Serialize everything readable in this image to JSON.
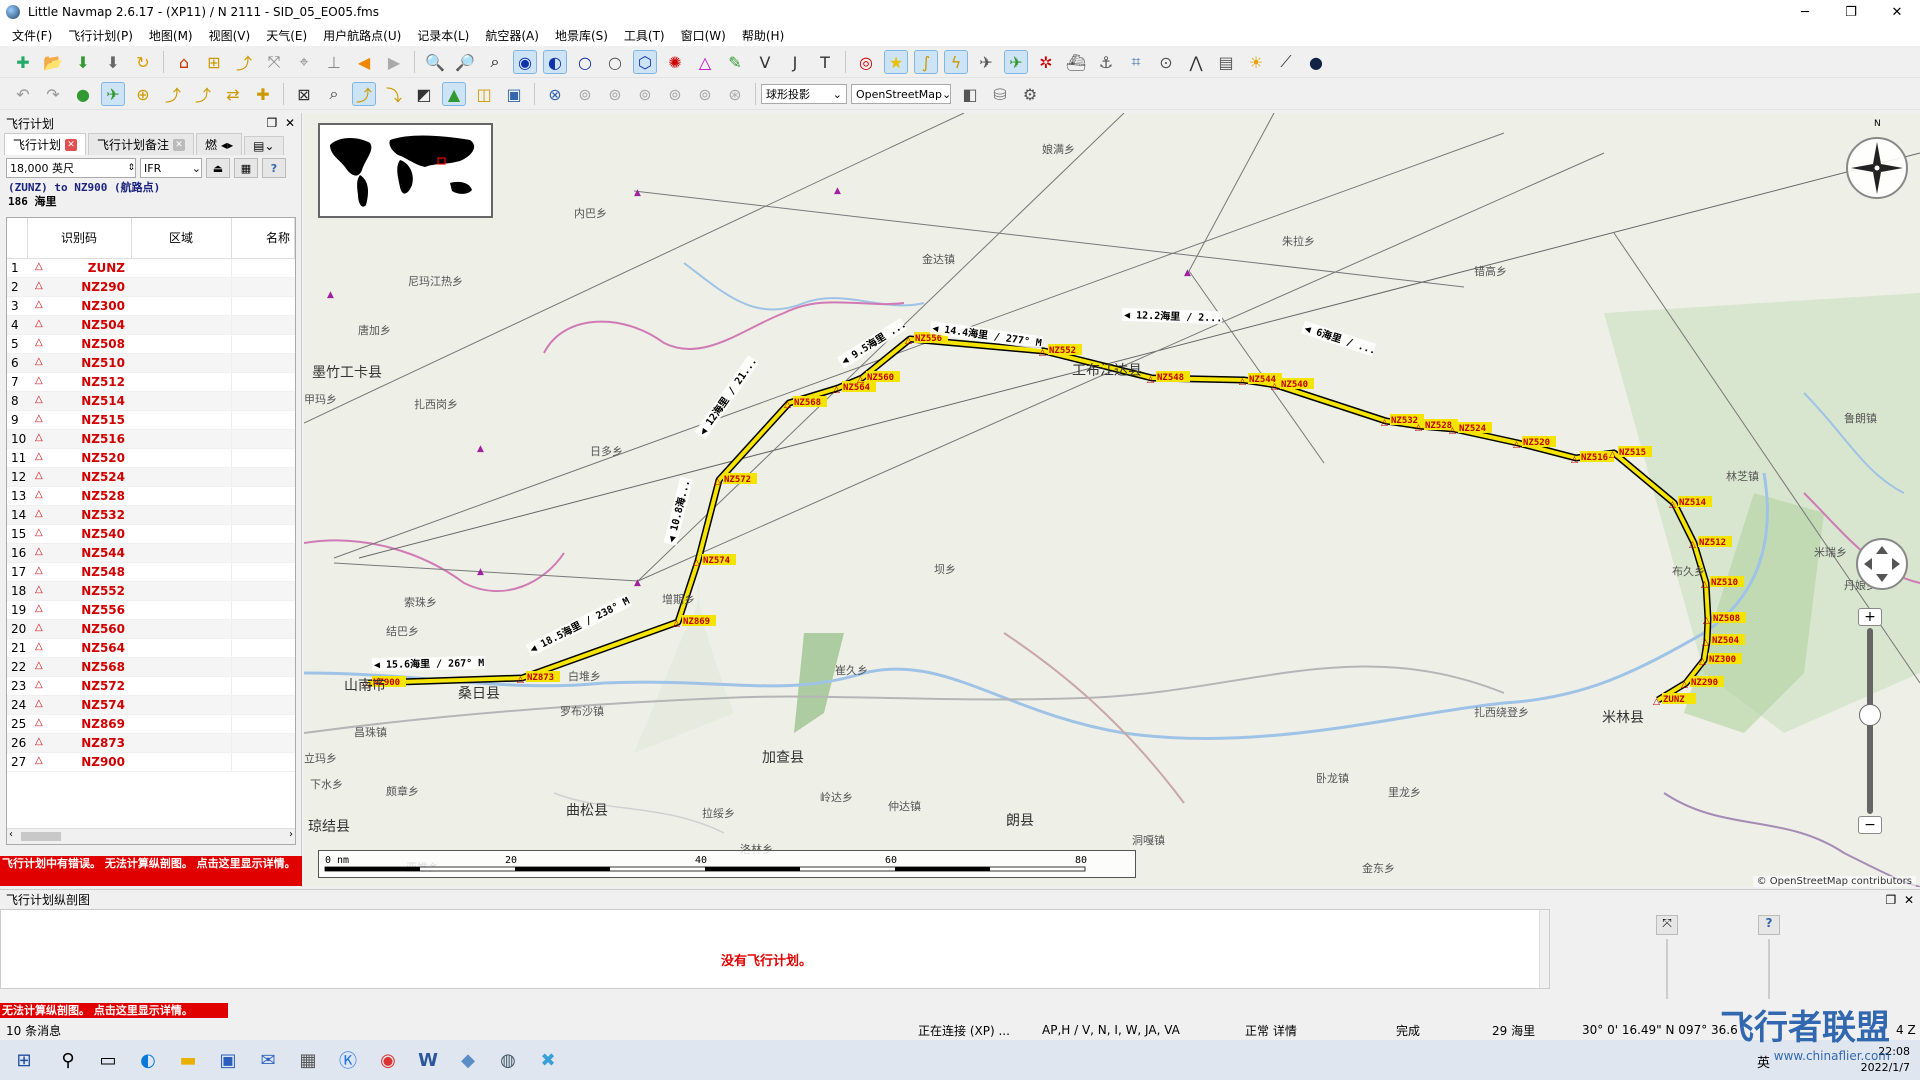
{
  "window": {
    "title": "Little Navmap 2.6.17 - (XP11) / N 2111 - SID_05_EO05.fms",
    "minimize": "─",
    "maximize": "❐",
    "close": "✕"
  },
  "menu": [
    "文件(F)",
    "飞行计划(P)",
    "地图(M)",
    "视图(V)",
    "天气(E)",
    "用户航路点(U)",
    "记录本(L)",
    "航空器(A)",
    "地景库(S)",
    "工具(T)",
    "窗口(W)",
    "帮助(H)"
  ],
  "toolbar2": {
    "projection": "球形投影",
    "theme": "OpenStreetMap"
  },
  "left_panel": {
    "title": "飞行计划",
    "tabs": [
      "飞行计划",
      "飞行计划备注",
      "燃"
    ],
    "altitude": "18,000 英尺",
    "flight_rules": "IFR",
    "route_text": "(ZUNZ) to NZ900 (航路点)",
    "distance_text": "186 海里",
    "columns": [
      "识别码",
      "区域",
      "名称"
    ],
    "rows": [
      {
        "n": "1",
        "ident": "ZUNZ"
      },
      {
        "n": "2",
        "ident": "NZ290"
      },
      {
        "n": "3",
        "ident": "NZ300"
      },
      {
        "n": "4",
        "ident": "NZ504"
      },
      {
        "n": "5",
        "ident": "NZ508"
      },
      {
        "n": "6",
        "ident": "NZ510"
      },
      {
        "n": "7",
        "ident": "NZ512"
      },
      {
        "n": "8",
        "ident": "NZ514"
      },
      {
        "n": "9",
        "ident": "NZ515"
      },
      {
        "n": "10",
        "ident": "NZ516"
      },
      {
        "n": "11",
        "ident": "NZ520"
      },
      {
        "n": "12",
        "ident": "NZ524"
      },
      {
        "n": "13",
        "ident": "NZ528"
      },
      {
        "n": "14",
        "ident": "NZ532"
      },
      {
        "n": "15",
        "ident": "NZ540"
      },
      {
        "n": "16",
        "ident": "NZ544"
      },
      {
        "n": "17",
        "ident": "NZ548"
      },
      {
        "n": "18",
        "ident": "NZ552"
      },
      {
        "n": "19",
        "ident": "NZ556"
      },
      {
        "n": "20",
        "ident": "NZ560"
      },
      {
        "n": "21",
        "ident": "NZ564"
      },
      {
        "n": "22",
        "ident": "NZ568"
      },
      {
        "n": "23",
        "ident": "NZ572"
      },
      {
        "n": "24",
        "ident": "NZ574"
      },
      {
        "n": "25",
        "ident": "NZ869"
      },
      {
        "n": "26",
        "ident": "NZ873"
      },
      {
        "n": "27",
        "ident": "NZ900"
      }
    ],
    "error_banner": "飞行计划中有错误。 无法计算纵剖图。 点击这里显示详情。"
  },
  "map": {
    "place_labels": [
      {
        "t": "娘满乡"
      },
      {
        "t": "内巴乡"
      },
      {
        "t": "金达镇"
      },
      {
        "t": "朱拉乡"
      },
      {
        "t": "尼玛江热乡"
      },
      {
        "t": "错高乡"
      },
      {
        "t": "唐加乡"
      },
      {
        "t": "工布江达县"
      },
      {
        "t": "墨竹工卡县"
      },
      {
        "t": "甲玛乡"
      },
      {
        "t": "扎西岗乡"
      },
      {
        "t": "日多乡"
      },
      {
        "t": "鲁朗镇"
      },
      {
        "t": "林芝镇"
      },
      {
        "t": "米瑞乡"
      },
      {
        "t": "布久乡"
      },
      {
        "t": "丹娘乡"
      },
      {
        "t": "坝乡"
      },
      {
        "t": "索珠乡"
      },
      {
        "t": "结巴乡"
      },
      {
        "t": "崔久乡"
      },
      {
        "t": "白堆乡"
      },
      {
        "t": "罗布沙镇"
      },
      {
        "t": "扎西绕登乡"
      },
      {
        "t": "米林县"
      },
      {
        "t": "山南市"
      },
      {
        "t": "昌珠镇"
      },
      {
        "t": "加查县"
      },
      {
        "t": "立玛乡"
      },
      {
        "t": "下水乡"
      },
      {
        "t": "颇章乡"
      },
      {
        "t": "岭达乡"
      },
      {
        "t": "曲松县"
      },
      {
        "t": "拉绥乡"
      },
      {
        "t": "仲达镇"
      },
      {
        "t": "朗县"
      },
      {
        "t": "卧龙镇"
      },
      {
        "t": "里龙乡"
      },
      {
        "t": "琼结县"
      },
      {
        "t": "洛林乡"
      },
      {
        "t": "洞嘎镇"
      },
      {
        "t": "金东乡"
      },
      {
        "t": "亚堆乡"
      },
      {
        "t": "桑日县"
      },
      {
        "t": "增期乡"
      }
    ],
    "leg_labels": [
      "◀ 15.6海里 / 267° M",
      "◀ 18.5海里 / 238° M",
      "◀ 10.8海...",
      "◀ 12海里 / 21...",
      "◀ 9.5海里 ...",
      "◀ 14.4海里 / 277° M",
      "◀ 12.2海里 / 2...",
      "◀ 6海里 / ..."
    ],
    "waypoints": [
      {
        "id": "NZ900"
      },
      {
        "id": "NZ873"
      },
      {
        "id": "NZ869"
      },
      {
        "id": "NZ574"
      },
      {
        "id": "NZ572"
      },
      {
        "id": "NZ568"
      },
      {
        "id": "NZ564"
      },
      {
        "id": "NZ560"
      },
      {
        "id": "NZ556"
      },
      {
        "id": "NZ552"
      },
      {
        "id": "NZ548"
      },
      {
        "id": "NZ544"
      },
      {
        "id": "NZ540"
      },
      {
        "id": "NZ532"
      },
      {
        "id": "NZ528"
      },
      {
        "id": "NZ524"
      },
      {
        "id": "NZ520"
      },
      {
        "id": "NZ516"
      },
      {
        "id": "NZ515"
      },
      {
        "id": "NZ514"
      },
      {
        "id": "NZ512"
      },
      {
        "id": "NZ510"
      },
      {
        "id": "NZ508"
      },
      {
        "id": "NZ504"
      },
      {
        "id": "NZ300"
      },
      {
        "id": "NZ290"
      },
      {
        "id": "ZUNZ"
      }
    ],
    "scale_ticks": [
      "0 nm",
      "20",
      "40",
      "60",
      "80"
    ],
    "compass_n": "N",
    "zoom_in": "+",
    "zoom_out": "−",
    "credit": "© OpenStreetMap contributors"
  },
  "profile": {
    "title": "飞行计划纵剖图",
    "message": "没有飞行计划。",
    "error": "无法计算纵剖图。 点击这里显示详情。"
  },
  "statusbar": {
    "messages": "10 条消息",
    "connection": "正在连接 (XP) ...",
    "flags": "AP,H / V, N, I, W, JA, VA",
    "detail": "正常 详情",
    "done": "完成",
    "distance": "29 海里",
    "coords": "30° 0' 16.49\" N 097° 36.6",
    "right_clip": "4 Z"
  },
  "taskbar": {
    "time": "22:08",
    "date": "2022/1/7",
    "lang": "英"
  },
  "watermark": {
    "main": "飞行者联盟",
    "sub": "www.chinaflier.com"
  },
  "colors": {
    "route": "#f5e400",
    "route_outline": "#000000",
    "waypoint_label_bg": "#f5e400",
    "waypoint_label": "#c00000",
    "error": "#e00000"
  }
}
